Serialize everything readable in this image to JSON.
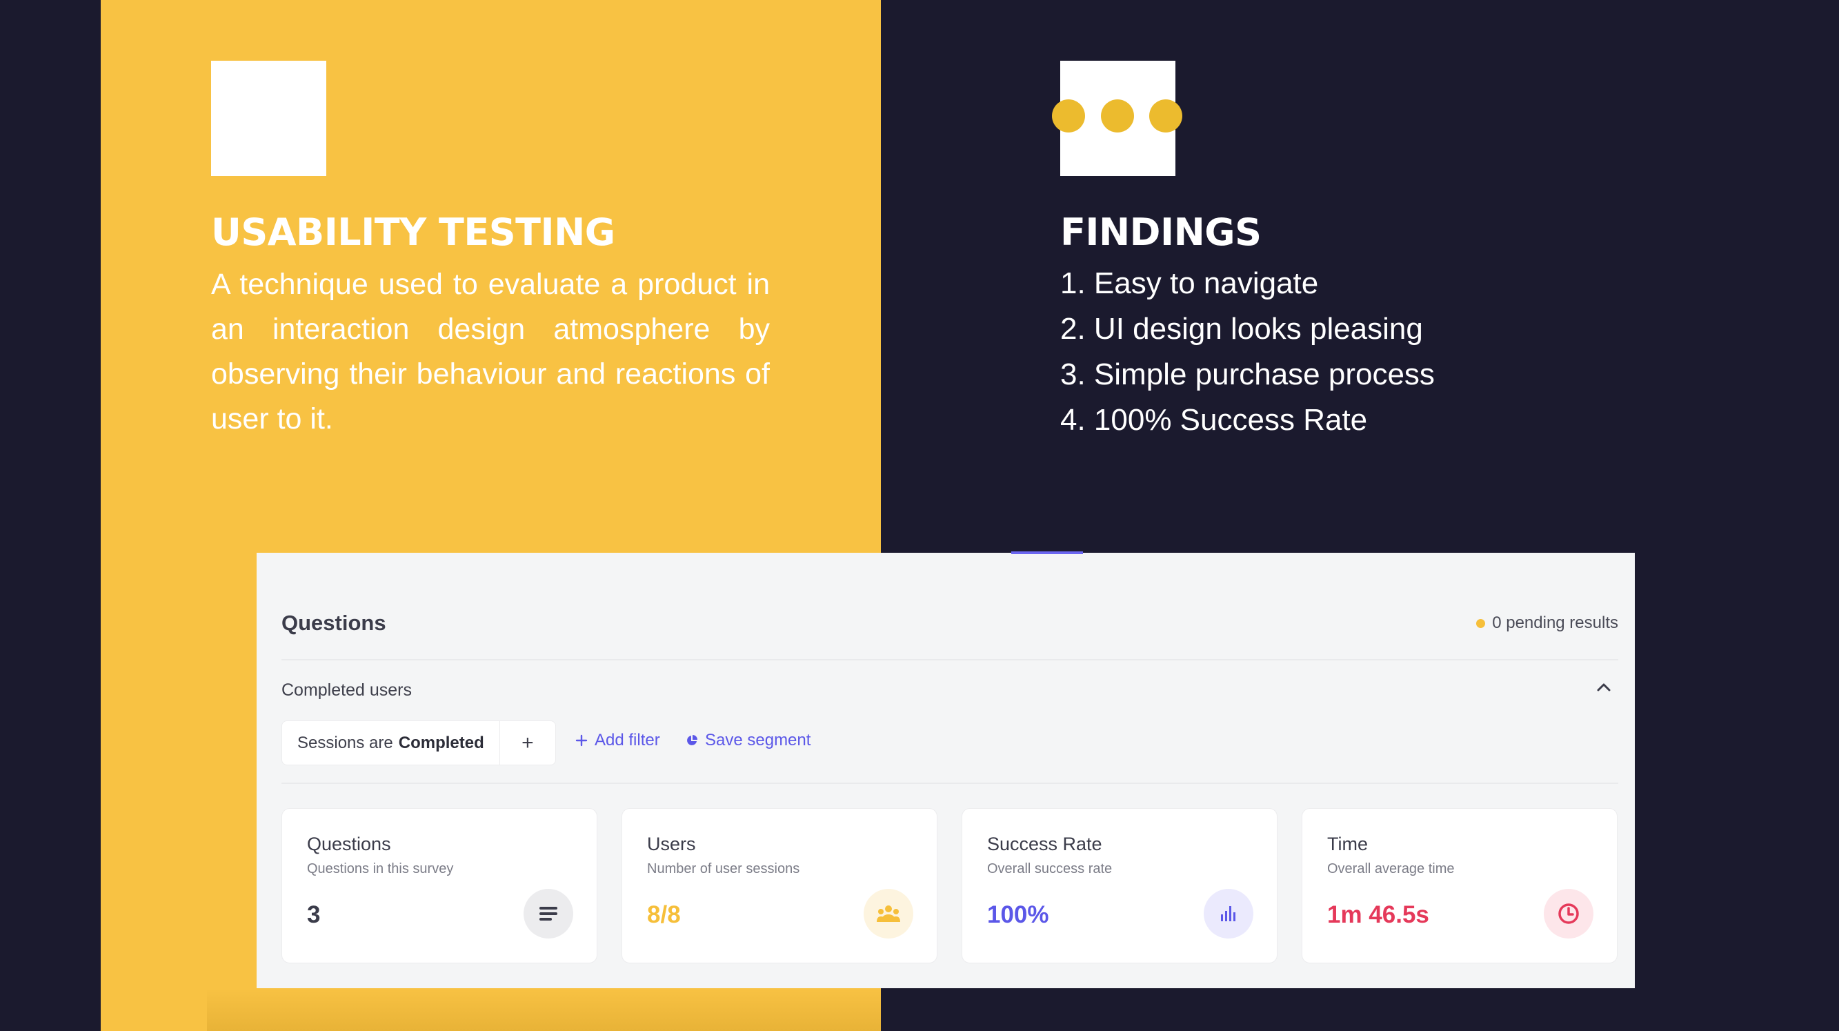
{
  "colors": {
    "background": "#1b1a2e",
    "yellow_panel": "#f8c243",
    "dot": "#ecbb2e",
    "accent_purple": "#5b57e8",
    "users_yellow": "#f6bf3a",
    "time_red": "#e5395a"
  },
  "left": {
    "title": "USABILITY TESTING",
    "body": "A technique used to evaluate a product  in an interaction design atmosphere by observing their behaviour and reactions of user to it."
  },
  "right": {
    "title": "FINDINGS",
    "items": [
      "1. Easy to navigate",
      "2. UI design looks pleasing",
      "3. Simple purchase process",
      "4. 100% Success Rate"
    ]
  },
  "dashboard": {
    "title": "Questions",
    "pending": "0 pending results",
    "section": "Completed users",
    "filter": {
      "prefix": "Sessions are",
      "value": "Completed",
      "add_symbol": "+"
    },
    "add_filter": "Add filter",
    "save_segment": "Save segment",
    "cards": [
      {
        "title": "Questions",
        "subtitle": "Questions in this survey",
        "value": "3",
        "icon": "list-icon"
      },
      {
        "title": "Users",
        "subtitle": "Number of user sessions",
        "value": "8/8",
        "icon": "users-icon"
      },
      {
        "title": "Success Rate",
        "subtitle": "Overall success rate",
        "value": "100%",
        "icon": "bar-chart-icon"
      },
      {
        "title": "Time",
        "subtitle": "Overall average time",
        "value": "1m 46.5s",
        "icon": "clock-icon"
      }
    ]
  }
}
